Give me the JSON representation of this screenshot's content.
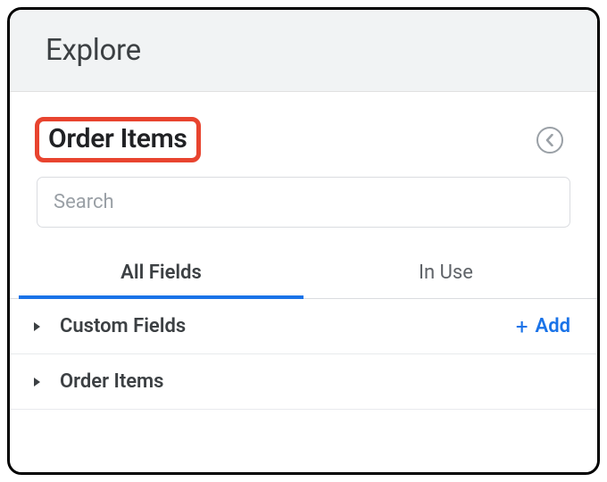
{
  "header": {
    "title": "Explore"
  },
  "section": {
    "title": "Order Items"
  },
  "search": {
    "placeholder": "Search",
    "value": ""
  },
  "tabs": {
    "all_fields": "All Fields",
    "in_use": "In Use",
    "active": "all_fields"
  },
  "list": {
    "items": [
      {
        "label": "Custom Fields",
        "has_add": true
      },
      {
        "label": "Order Items",
        "has_add": false
      }
    ],
    "add_label": "Add"
  },
  "colors": {
    "accent": "#1a73e8",
    "highlight_border": "#e8442f"
  }
}
